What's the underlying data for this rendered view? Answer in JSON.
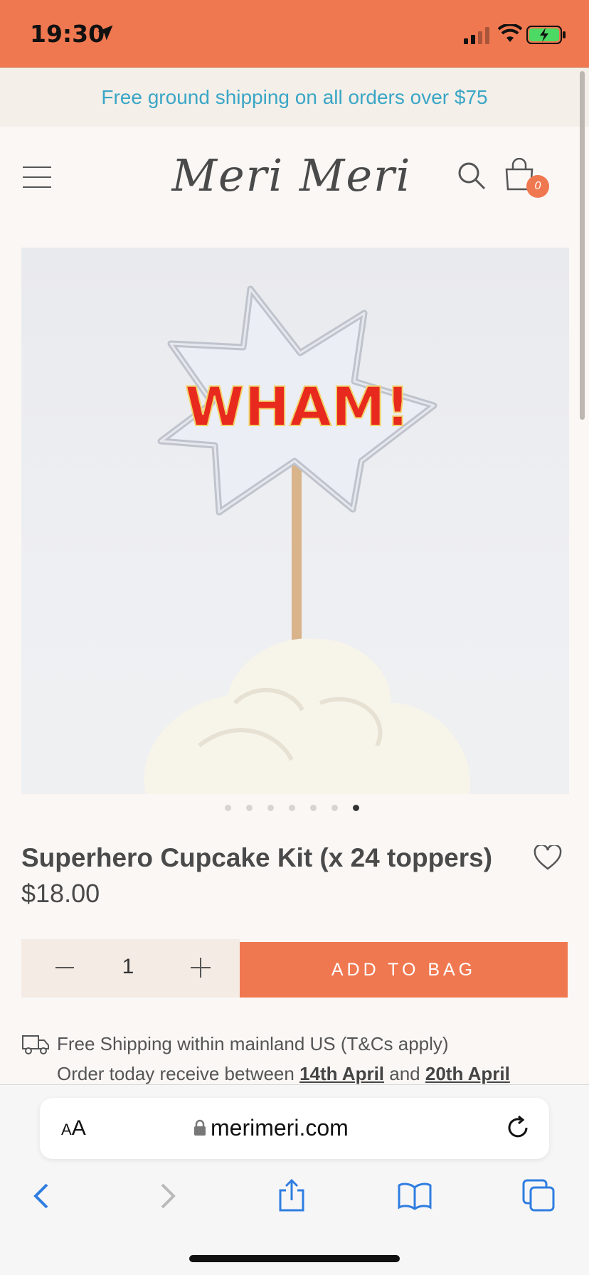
{
  "status_bar": {
    "time": "19:30"
  },
  "announcement": {
    "text": "Free ground shipping on all orders over $75"
  },
  "header": {
    "logo": "Meri Meri",
    "cart_count": "0"
  },
  "product": {
    "image_text": "WHAM!",
    "title": "Superhero Cupcake Kit (x 24 toppers)",
    "price": "$18.00",
    "gallery_count": 7,
    "gallery_active_index": 6
  },
  "purchase": {
    "quantity": "1",
    "add_label": "ADD TO BAG"
  },
  "shipping": {
    "line1": "Free Shipping within mainland US (T&Cs apply)",
    "line2_prefix": "Order today receive between ",
    "date_start": "14th April",
    "line2_mid": " and ",
    "date_end": "20th April"
  },
  "browser": {
    "aa_small": "A",
    "aa_large": "A",
    "url": "merimeri.com"
  },
  "colors": {
    "accent": "#f07850",
    "announcement_text": "#3aa6c6"
  }
}
